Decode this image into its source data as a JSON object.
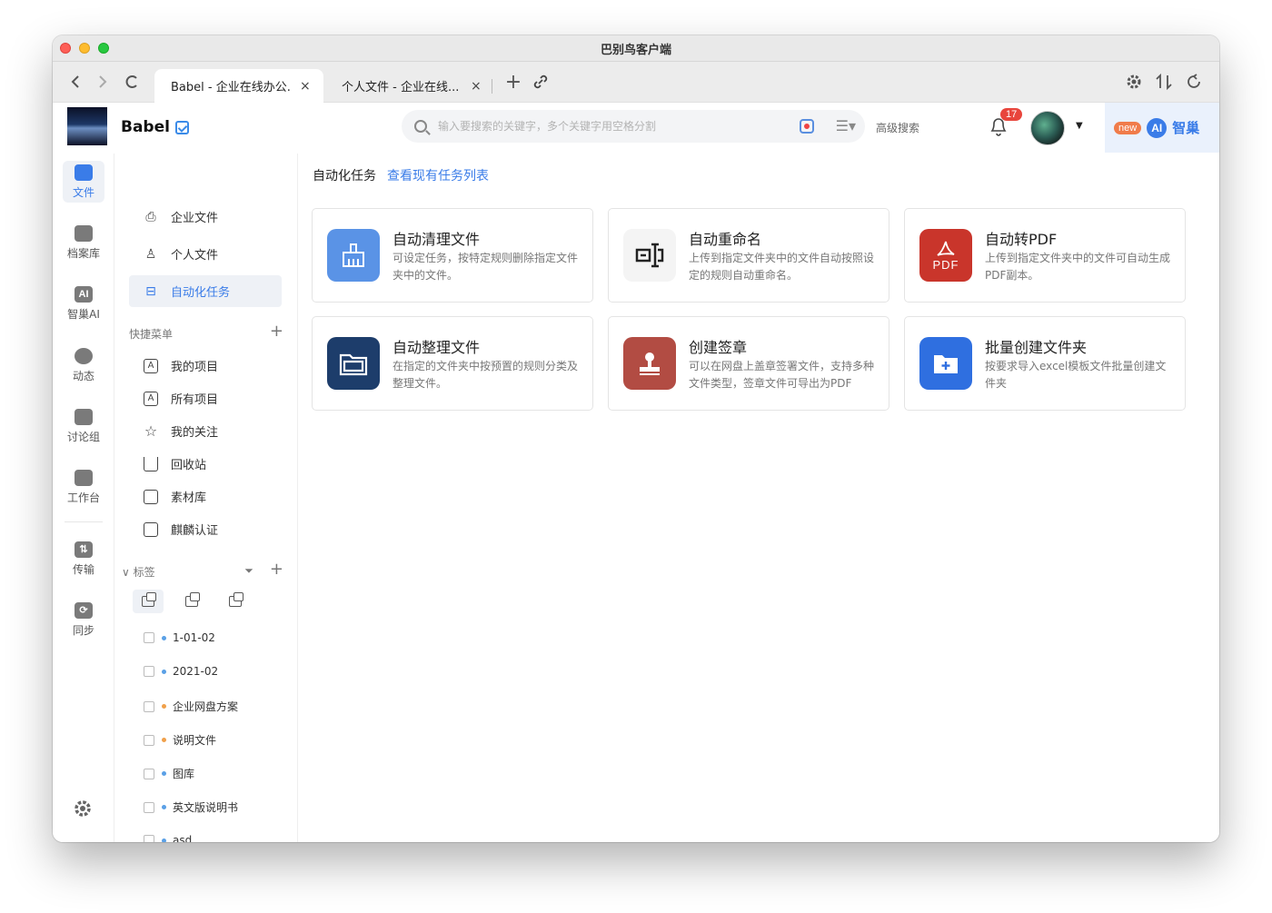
{
  "window": {
    "title": "巴别鸟客户端"
  },
  "tabs": [
    {
      "label": "Babel - 企业在线办公...",
      "close": "×"
    },
    {
      "label": "个人文件 - 企业在线...",
      "close": "×"
    }
  ],
  "tabbar": {
    "new_tab": "+",
    "link": "🔗",
    "back": "‹",
    "forward": "›",
    "reload": "C"
  },
  "header": {
    "brand": "Babel",
    "search_placeholder": "输入要搜索的关键字，多个关键字用空格分割",
    "advanced_search": "高级搜索",
    "notification_count": "17",
    "ai_new": "new",
    "ai_logo": "AI",
    "ai_label": "智巢"
  },
  "rail": [
    {
      "label": "文件",
      "icon": "folder-icon",
      "glyph": ""
    },
    {
      "label": "档案库",
      "icon": "archive-icon",
      "glyph": ""
    },
    {
      "label": "智巢AI",
      "icon": "ai-icon",
      "glyph": "AI"
    },
    {
      "label": "动态",
      "icon": "activity-icon",
      "glyph": ""
    },
    {
      "label": "讨论组",
      "icon": "chat-icon",
      "glyph": ""
    },
    {
      "label": "工作台",
      "icon": "workbench-icon",
      "glyph": ""
    },
    {
      "label": "传输",
      "icon": "transfer-icon",
      "glyph": "⇅"
    },
    {
      "label": "同步",
      "icon": "sync-icon",
      "glyph": "⟳"
    }
  ],
  "sidebar": {
    "nav": [
      {
        "label": "企业文件",
        "icon": "enterprise-files-icon",
        "glyph": "⎙"
      },
      {
        "label": "个人文件",
        "icon": "personal-files-icon",
        "glyph": "♙"
      },
      {
        "label": "自动化任务",
        "icon": "automation-icon",
        "glyph": "⊟"
      }
    ],
    "quick_menu_title": "快捷菜单",
    "quick_menu": [
      {
        "label": "我的项目",
        "icon": "my-projects-icon",
        "glyph": "A"
      },
      {
        "label": "所有项目",
        "icon": "all-projects-icon",
        "glyph": "A"
      },
      {
        "label": "我的关注",
        "icon": "star-icon",
        "glyph": "☆"
      },
      {
        "label": "回收站",
        "icon": "trash-icon",
        "glyph": "🗑"
      },
      {
        "label": "素材库",
        "icon": "image-library-icon",
        "glyph": "⛰"
      },
      {
        "label": "麒麟认证",
        "icon": "certification-folder-icon",
        "glyph": ""
      }
    ],
    "tags_title": "标签",
    "tags": [
      {
        "label": "1-01-02",
        "color": "#5aa0e6"
      },
      {
        "label": "2021-02",
        "color": "#5aa0e6"
      },
      {
        "label": "企业网盘方案",
        "color": "#f0a04a"
      },
      {
        "label": "说明文件",
        "color": "#f0a04a"
      },
      {
        "label": "图库",
        "color": "#5aa0e6"
      },
      {
        "label": "英文版说明书",
        "color": "#5aa0e6"
      },
      {
        "label": "asd",
        "color": "#5aa0e6"
      }
    ]
  },
  "main": {
    "title": "自动化任务",
    "link": "查看现有任务列表",
    "cards": [
      {
        "title": "自动清理文件",
        "desc": "可设定任务，按特定规则删除指定文件夹中的文件。",
        "icon": "broom-icon",
        "glyph": "🧹",
        "bg": "#5a93e6"
      },
      {
        "title": "自动重命名",
        "desc": "上传到指定文件夹中的文件自动按照设定的规则自动重命名。",
        "icon": "rename-icon",
        "glyph": "⌶",
        "bg": "#ffffff"
      },
      {
        "title": "自动转PDF",
        "desc": "上传到指定文件夹中的文件可自动生成PDF副本。",
        "icon": "pdf-icon",
        "glyph": "PDF",
        "bg": "#c9352b"
      },
      {
        "title": "自动整理文件",
        "desc": "在指定的文件夹中按预置的规则分类及整理文件。",
        "icon": "organize-folder-icon",
        "glyph": "🗂",
        "bg": "#1d3d6b"
      },
      {
        "title": "创建签章",
        "desc": "可以在网盘上盖章签署文件，支持多种文件类型，签章文件可导出为PDF",
        "icon": "stamp-icon",
        "glyph": "⊥",
        "bg": "#b24c43"
      },
      {
        "title": "批量创建文件夹",
        "desc": "按要求导入excel模板文件批量创建文件夹",
        "icon": "batch-folder-icon",
        "glyph": "+",
        "bg": "#2f6fe0"
      }
    ]
  }
}
